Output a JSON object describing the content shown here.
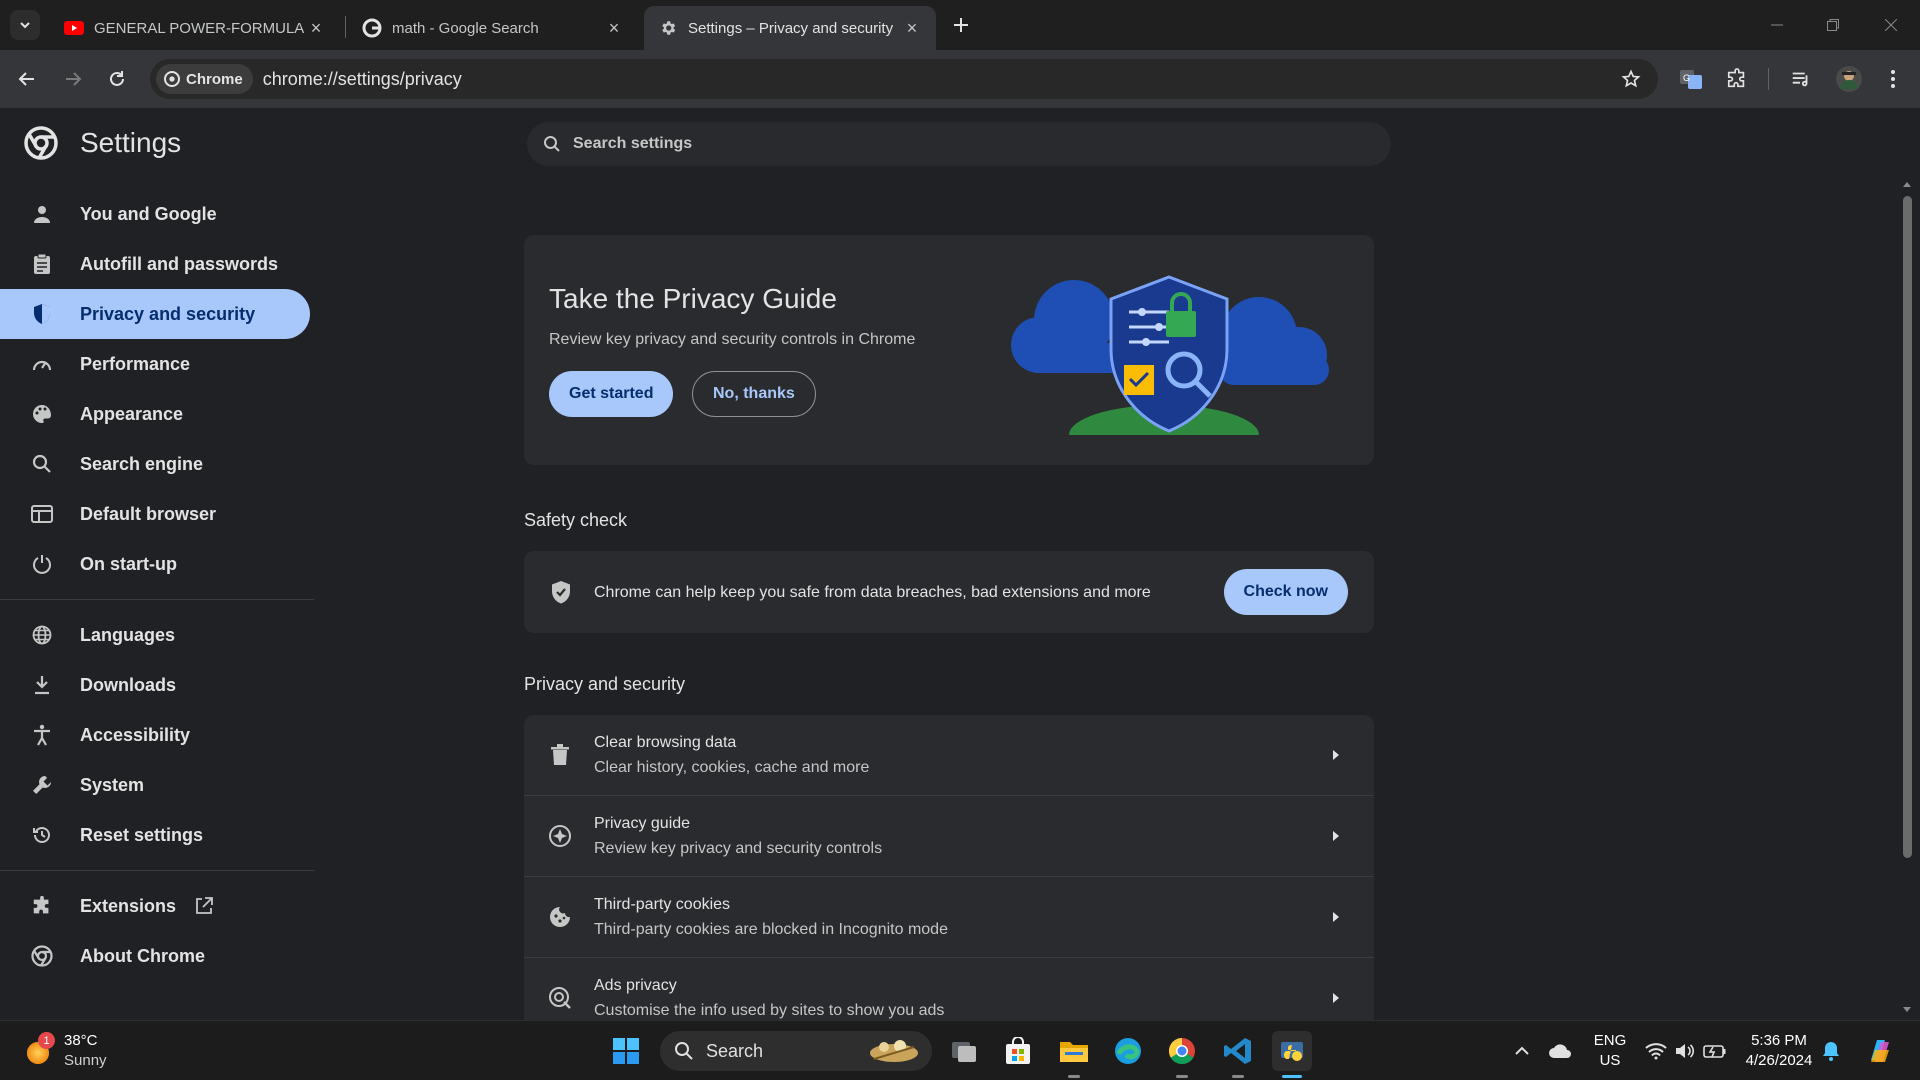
{
  "tabs": [
    {
      "title": "GENERAL POWER-FORMULA OF",
      "favicon": "youtube-icon"
    },
    {
      "title": "math - Google Search",
      "favicon": "google-icon"
    },
    {
      "title": "Settings – Privacy and security",
      "favicon": "gear-icon",
      "active": true
    }
  ],
  "omnibox": {
    "chip_label": "Chrome",
    "url": "chrome://settings/privacy"
  },
  "settings": {
    "title": "Settings",
    "search_placeholder": "Search settings",
    "nav": [
      {
        "label": "You and Google",
        "icon": "person-icon"
      },
      {
        "label": "Autofill and passwords",
        "icon": "clipboard-icon"
      },
      {
        "label": "Privacy and security",
        "icon": "shield-icon",
        "active": true
      },
      {
        "label": "Performance",
        "icon": "speedometer-icon"
      },
      {
        "label": "Appearance",
        "icon": "palette-icon"
      },
      {
        "label": "Search engine",
        "icon": "search-icon"
      },
      {
        "label": "Default browser",
        "icon": "browser-icon"
      },
      {
        "label": "On start-up",
        "icon": "power-icon"
      },
      {
        "label": "Languages",
        "icon": "globe-icon"
      },
      {
        "label": "Downloads",
        "icon": "download-icon"
      },
      {
        "label": "Accessibility",
        "icon": "accessibility-icon"
      },
      {
        "label": "System",
        "icon": "wrench-icon"
      },
      {
        "label": "Reset settings",
        "icon": "history-icon"
      },
      {
        "label": "Extensions",
        "icon": "puzzle-icon"
      },
      {
        "label": "About Chrome",
        "icon": "chrome-icon"
      }
    ],
    "privacy_guide": {
      "title": "Take the Privacy Guide",
      "subtitle": "Review key privacy and security controls in Chrome",
      "primary_button": "Get started",
      "secondary_button": "No, thanks"
    },
    "safety_check": {
      "heading": "Safety check",
      "text": "Chrome can help keep you safe from data breaches, bad extensions and more",
      "button": "Check now"
    },
    "privacy_section": {
      "heading": "Privacy and security",
      "rows": [
        {
          "title": "Clear browsing data",
          "subtitle": "Clear history, cookies, cache and more",
          "icon": "trash-icon"
        },
        {
          "title": "Privacy guide",
          "subtitle": "Review key privacy and security controls",
          "icon": "compass-icon"
        },
        {
          "title": "Third-party cookies",
          "subtitle": "Third-party cookies are blocked in Incognito mode",
          "icon": "cookie-icon"
        },
        {
          "title": "Ads privacy",
          "subtitle": "Customise the info used by sites to show you ads",
          "icon": "ads-privacy-icon"
        }
      ]
    }
  },
  "taskbar": {
    "weather_temp": "38°C",
    "weather_cond": "Sunny",
    "weather_badge": "1",
    "search_label": "Search",
    "lang_top": "ENG",
    "lang_bottom": "US",
    "time": "5:36 PM",
    "date": "4/26/2024"
  },
  "colors": {
    "accent": "#a8c7fa",
    "accent_text": "#062e6f",
    "page_bg": "#202124",
    "card_bg": "#2a2b2e"
  }
}
